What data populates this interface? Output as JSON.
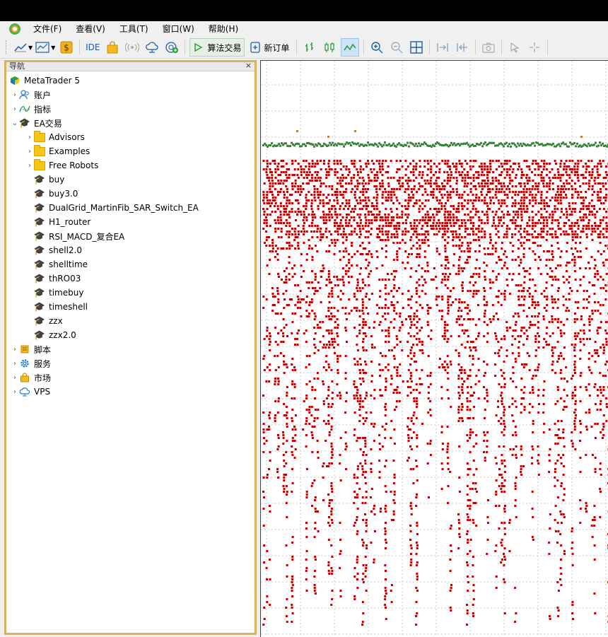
{
  "menu": {
    "items": [
      "文件(F)",
      "查看(V)",
      "工具(T)",
      "窗口(W)",
      "帮助(H)"
    ]
  },
  "toolbar": {
    "ide_label": "IDE",
    "algo_trading_label": "算法交易",
    "new_order_label": "新订单"
  },
  "navigator": {
    "title": "导航",
    "close_label": "×",
    "root": "MetaTrader 5",
    "accounts": "账户",
    "indicators": "指标",
    "experts": "EA交易",
    "folders": [
      "Advisors",
      "Examples",
      "Free Robots"
    ],
    "experts_list": [
      "buy",
      "buy3.0",
      "DualGrid_MartinFib_SAR_Switch_EA",
      "H1_router",
      "RSI_MACD_复合EA",
      "shell2.0",
      "shelltime",
      "thRO03",
      "timebuy",
      "timeshell",
      "zzx",
      "zzx2.0"
    ],
    "scripts": "脚本",
    "services": "服务",
    "market": "市场",
    "vps": "VPS"
  },
  "colors": {
    "panel_border": "#d9b15f",
    "dot_red": "#c00000",
    "dot_green": "#2e8b2e",
    "dot_orange": "#e07b00",
    "ea_icon": "#1d79c7"
  }
}
